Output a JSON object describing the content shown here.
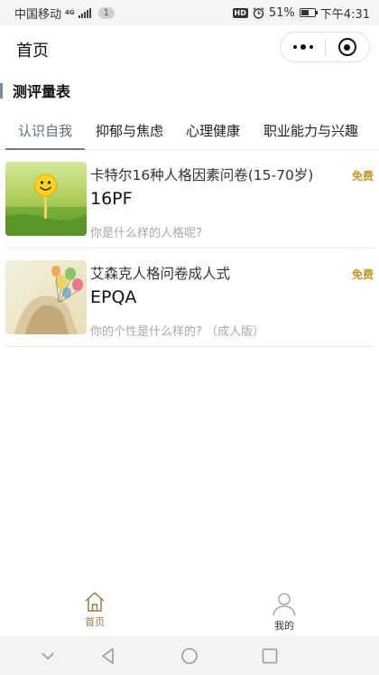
{
  "status_bar": {
    "carrier": "中国移动",
    "network": "4G",
    "notification_count": "1",
    "hd": "HD",
    "battery_percent": "51%",
    "time": "下午4:31"
  },
  "nav": {
    "title": "首页"
  },
  "section": {
    "title": "测评量表"
  },
  "tabs": [
    {
      "label": "认识自我",
      "active": true
    },
    {
      "label": "抑郁与焦虑",
      "active": false
    },
    {
      "label": "心理健康",
      "active": false
    },
    {
      "label": "职业能力与兴趣",
      "active": false
    }
  ],
  "tests": [
    {
      "title": "卡特尔16种人格因素问卷(15-70岁)",
      "code": "16PF",
      "description": "你是什么样的人格呢?",
      "price": "免费",
      "thumbnail": "smiley-on-grass"
    },
    {
      "title": "艾森克人格问卷成人式",
      "code": "EPQA",
      "description": "你的个性是什么样的? （成人版）",
      "price": "免费",
      "thumbnail": "balloons-and-dog"
    }
  ],
  "tabbar": [
    {
      "label": "首页",
      "icon": "home-icon",
      "active": true
    },
    {
      "label": "我的",
      "icon": "user-icon",
      "active": false
    }
  ],
  "colors": {
    "accent": "#5b6f86",
    "price": "#c8952a",
    "tabbar_active": "#9a7b3e"
  }
}
